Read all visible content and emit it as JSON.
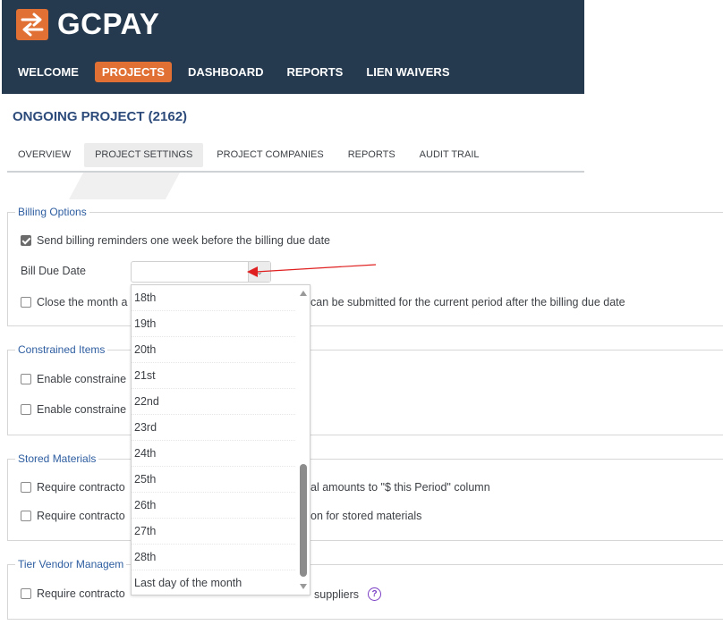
{
  "app": {
    "logo_text": "GCPAY",
    "brand_color": "#e07033",
    "header_color": "#253a4f"
  },
  "nav": {
    "items": [
      {
        "label": "WELCOME",
        "active": false
      },
      {
        "label": "PROJECTS",
        "active": true
      },
      {
        "label": "DASHBOARD",
        "active": false
      },
      {
        "label": "REPORTS",
        "active": false
      },
      {
        "label": "LIEN WAIVERS",
        "active": false
      }
    ]
  },
  "page": {
    "title": "ONGOING PROJECT (2162)"
  },
  "tabs": [
    {
      "label": "OVERVIEW",
      "active": false
    },
    {
      "label": "PROJECT SETTINGS",
      "active": true
    },
    {
      "label": "PROJECT COMPANIES",
      "active": false
    },
    {
      "label": "REPORTS",
      "active": false
    },
    {
      "label": "AUDIT TRAIL",
      "active": false
    }
  ],
  "billing_options": {
    "legend": "Billing Options",
    "send_reminders": {
      "label": "Send billing reminders one week before the billing due date",
      "checked": true
    },
    "bill_due_date": {
      "label": "Bill Due Date",
      "value": ""
    },
    "close_month": {
      "label_start": "Close the month a",
      "label_end": "can be submitted for the current period after the billing due date",
      "checked": false
    }
  },
  "constrained_items": {
    "legend": "Constrained Items",
    "options": [
      {
        "label": "Enable constraine",
        "checked": false
      },
      {
        "label": "Enable constraine",
        "checked": false
      }
    ]
  },
  "stored_materials": {
    "legend": "Stored Materials",
    "options": [
      {
        "label_start": "Require contracto",
        "label_end": "al amounts to \"$ this Period\" column",
        "checked": false
      },
      {
        "label_start": "Require contracto",
        "label_end": "on for stored materials",
        "checked": false
      }
    ]
  },
  "tier_vendor": {
    "legend": "Tier Vendor Managem",
    "option": {
      "label_start": "Require contracto",
      "label_end": "suppliers",
      "checked": false
    }
  },
  "dropdown": {
    "options": [
      "18th",
      "19th",
      "20th",
      "21st",
      "22nd",
      "23rd",
      "24th",
      "25th",
      "26th",
      "27th",
      "28th",
      "Last day of the month"
    ]
  },
  "annotation": {
    "arrow_color": "#e02020"
  }
}
